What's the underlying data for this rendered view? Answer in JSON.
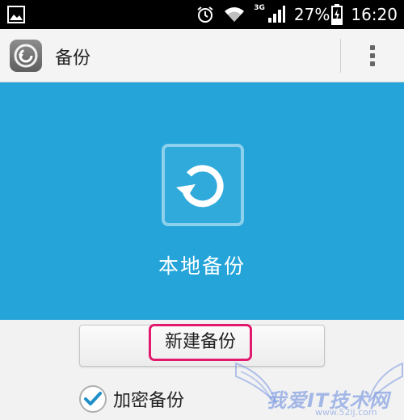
{
  "status_bar": {
    "network_type": "3G",
    "battery_percent": "27%",
    "time": "16:20",
    "icons": [
      "gallery-icon",
      "alarm-icon",
      "wifi-icon",
      "signal-icon",
      "battery-charging-icon"
    ]
  },
  "action_bar": {
    "app_icon": "backup-restore-icon",
    "title": "备份",
    "overflow_icon": "overflow-menu-icon"
  },
  "hero": {
    "icon": "restore-icon",
    "title": "本地备份",
    "background_color": "#24a4d9"
  },
  "actions": {
    "new_backup_label": "新建备份",
    "encrypt_label": "加密备份",
    "encrypt_checked": true,
    "highlight_color": "#e2196d"
  },
  "watermark": {
    "text": "我爱IT技术网",
    "url": "www.52ij.com"
  }
}
